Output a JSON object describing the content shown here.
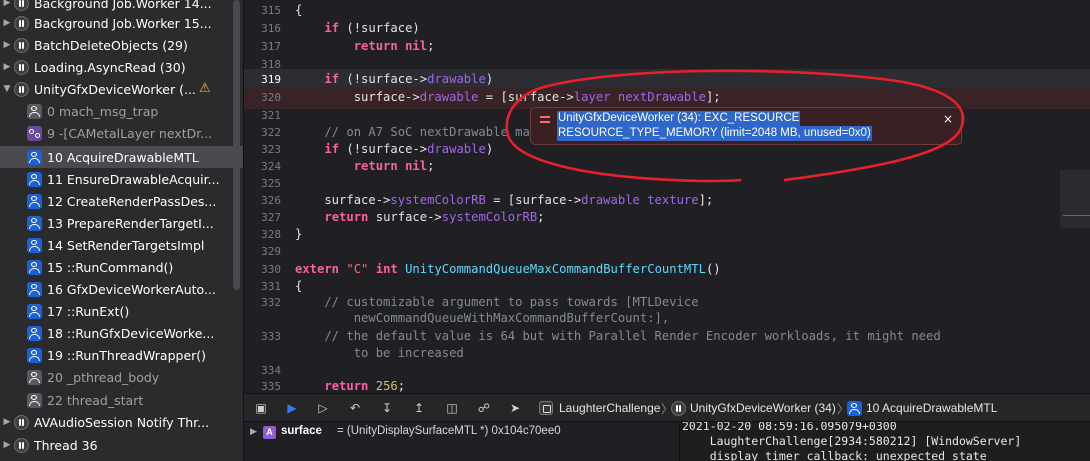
{
  "navigator": {
    "rows": [
      {
        "label": "Background Job.Worker 14...",
        "kind": "thread"
      },
      {
        "label": "Background Job.Worker 15...",
        "kind": "thread"
      },
      {
        "label": "BatchDeleteObjects (29)",
        "kind": "thread"
      },
      {
        "label": "Loading.AsyncRead (30)",
        "kind": "thread"
      },
      {
        "label": "UnityGfxDeviceWorker (...",
        "kind": "thread"
      },
      {
        "label": "0 mach_msg_trap",
        "kind": "frame-dim"
      },
      {
        "label": "9 -[CAMetalLayer nextDr...",
        "kind": "frame-objc"
      },
      {
        "label": "10 AcquireDrawableMTL",
        "kind": "frame"
      },
      {
        "label": "11 EnsureDrawableAcquir...",
        "kind": "frame"
      },
      {
        "label": "12 CreateRenderPassDes...",
        "kind": "frame"
      },
      {
        "label": "13 PrepareRenderTargetI...",
        "kind": "frame"
      },
      {
        "label": "14 SetRenderTargetsImpl",
        "kind": "frame"
      },
      {
        "label": "15 ::RunCommand()",
        "kind": "frame"
      },
      {
        "label": "16 GfxDeviceWorkerAuto...",
        "kind": "frame"
      },
      {
        "label": "17 ::RunExt()",
        "kind": "frame"
      },
      {
        "label": "18 ::RunGfxDeviceWorke...",
        "kind": "frame"
      },
      {
        "label": "19 ::RunThreadWrapper()",
        "kind": "frame"
      },
      {
        "label": "20 _pthread_body",
        "kind": "frame-dim"
      },
      {
        "label": "22 thread_start",
        "kind": "frame-dim"
      },
      {
        "label": "AVAudioSession Notify Thr...",
        "kind": "thread"
      },
      {
        "label": "Thread 36",
        "kind": "thread"
      }
    ],
    "warning_icon": "⚠"
  },
  "editor": {
    "line_numbers": [
      "315",
      "316",
      "317",
      "318",
      "319",
      "320",
      "321",
      "322",
      "323",
      "324",
      "325",
      "326",
      "327",
      "328",
      "329",
      "330",
      "331",
      "332",
      "",
      "333",
      "",
      "334",
      "335"
    ]
  },
  "error_popup": {
    "line1": "UnityGfxDeviceWorker (34): EXC_RESOURCE",
    "line2": "RESOURCE_TYPE_MEMORY (limit=2048 MB, unused=0x0)",
    "close": "×"
  },
  "debug_bar": {
    "crumb_app": "LaughterChallenge",
    "crumb_thread": "UnityGfxDeviceWorker (34)",
    "crumb_frame": "10 AcquireDrawableMTL",
    "separator": "〉"
  },
  "variables": {
    "badge": "A",
    "name": "surface",
    "value": "= (UnityDisplaySurfaceMTL *) 0x104c70ee0"
  },
  "console": {
    "lines": [
      "2021-02-20 08:59:16.095079+0300",
      "    LaughterChallenge[2934:580212] [WindowServer]",
      "    display_timer_callback: unexpected state"
    ]
  },
  "colors": {
    "error_highlight": "#382326",
    "selection": "#2f66c9",
    "annotation": "#e8202a"
  }
}
